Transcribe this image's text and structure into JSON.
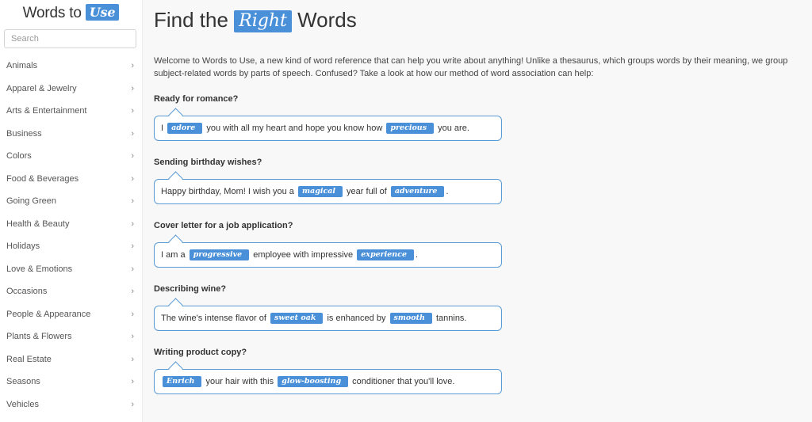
{
  "sidebar": {
    "logo": {
      "text": "Words to ",
      "badge": "Use"
    },
    "search": {
      "placeholder": "Search",
      "value": ""
    },
    "items": [
      {
        "label": "Animals"
      },
      {
        "label": "Apparel & Jewelry"
      },
      {
        "label": "Arts & Entertainment"
      },
      {
        "label": "Business"
      },
      {
        "label": "Colors"
      },
      {
        "label": "Food & Beverages"
      },
      {
        "label": "Going Green"
      },
      {
        "label": "Health & Beauty"
      },
      {
        "label": "Holidays"
      },
      {
        "label": "Love & Emotions"
      },
      {
        "label": "Occasions"
      },
      {
        "label": "People & Appearance"
      },
      {
        "label": "Plants & Flowers"
      },
      {
        "label": "Real Estate"
      },
      {
        "label": "Seasons"
      },
      {
        "label": "Vehicles"
      }
    ],
    "chevron_glyph": "›"
  },
  "main": {
    "title": {
      "before": "Find the ",
      "badge": "Right",
      "after": " Words"
    },
    "intro": "Welcome to Words to Use, a new kind of word reference that can help you write about anything! Unlike a thesaurus, which groups words by their meaning, we group subject-related words by parts of speech. Confused? Take a look at how our method of word association can help:",
    "examples": [
      {
        "heading": "Ready for romance?",
        "parts": [
          {
            "text": "I "
          },
          {
            "tag": "adore"
          },
          {
            "text": " you with all my heart and hope you know how "
          },
          {
            "tag": "precious"
          },
          {
            "text": " you are."
          }
        ]
      },
      {
        "heading": "Sending birthday wishes?",
        "parts": [
          {
            "text": "Happy birthday, Mom! I wish you a "
          },
          {
            "tag": "magical"
          },
          {
            "text": " year full of "
          },
          {
            "tag": "adventure"
          },
          {
            "text": "."
          }
        ]
      },
      {
        "heading": "Cover letter for a job application?",
        "parts": [
          {
            "text": "I am a "
          },
          {
            "tag": "progressive"
          },
          {
            "text": " employee with impressive "
          },
          {
            "tag": "experience"
          },
          {
            "text": "."
          }
        ]
      },
      {
        "heading": "Describing wine?",
        "parts": [
          {
            "text": "The wine's intense flavor of "
          },
          {
            "tag": "sweet oak"
          },
          {
            "text": " is enhanced by "
          },
          {
            "tag": "smooth"
          },
          {
            "text": " tannins."
          }
        ]
      },
      {
        "heading": "Writing product copy?",
        "parts": [
          {
            "tag": "Enrich"
          },
          {
            "text": " your hair with this "
          },
          {
            "tag": "glow-boosting"
          },
          {
            "text": " conditioner that you'll love."
          }
        ]
      }
    ]
  },
  "colors": {
    "accent": "#4a90d9",
    "bubble_border": "#5b9bd5",
    "page_bg": "#f8f8f8",
    "sidebar_bg": "#ffffff"
  }
}
